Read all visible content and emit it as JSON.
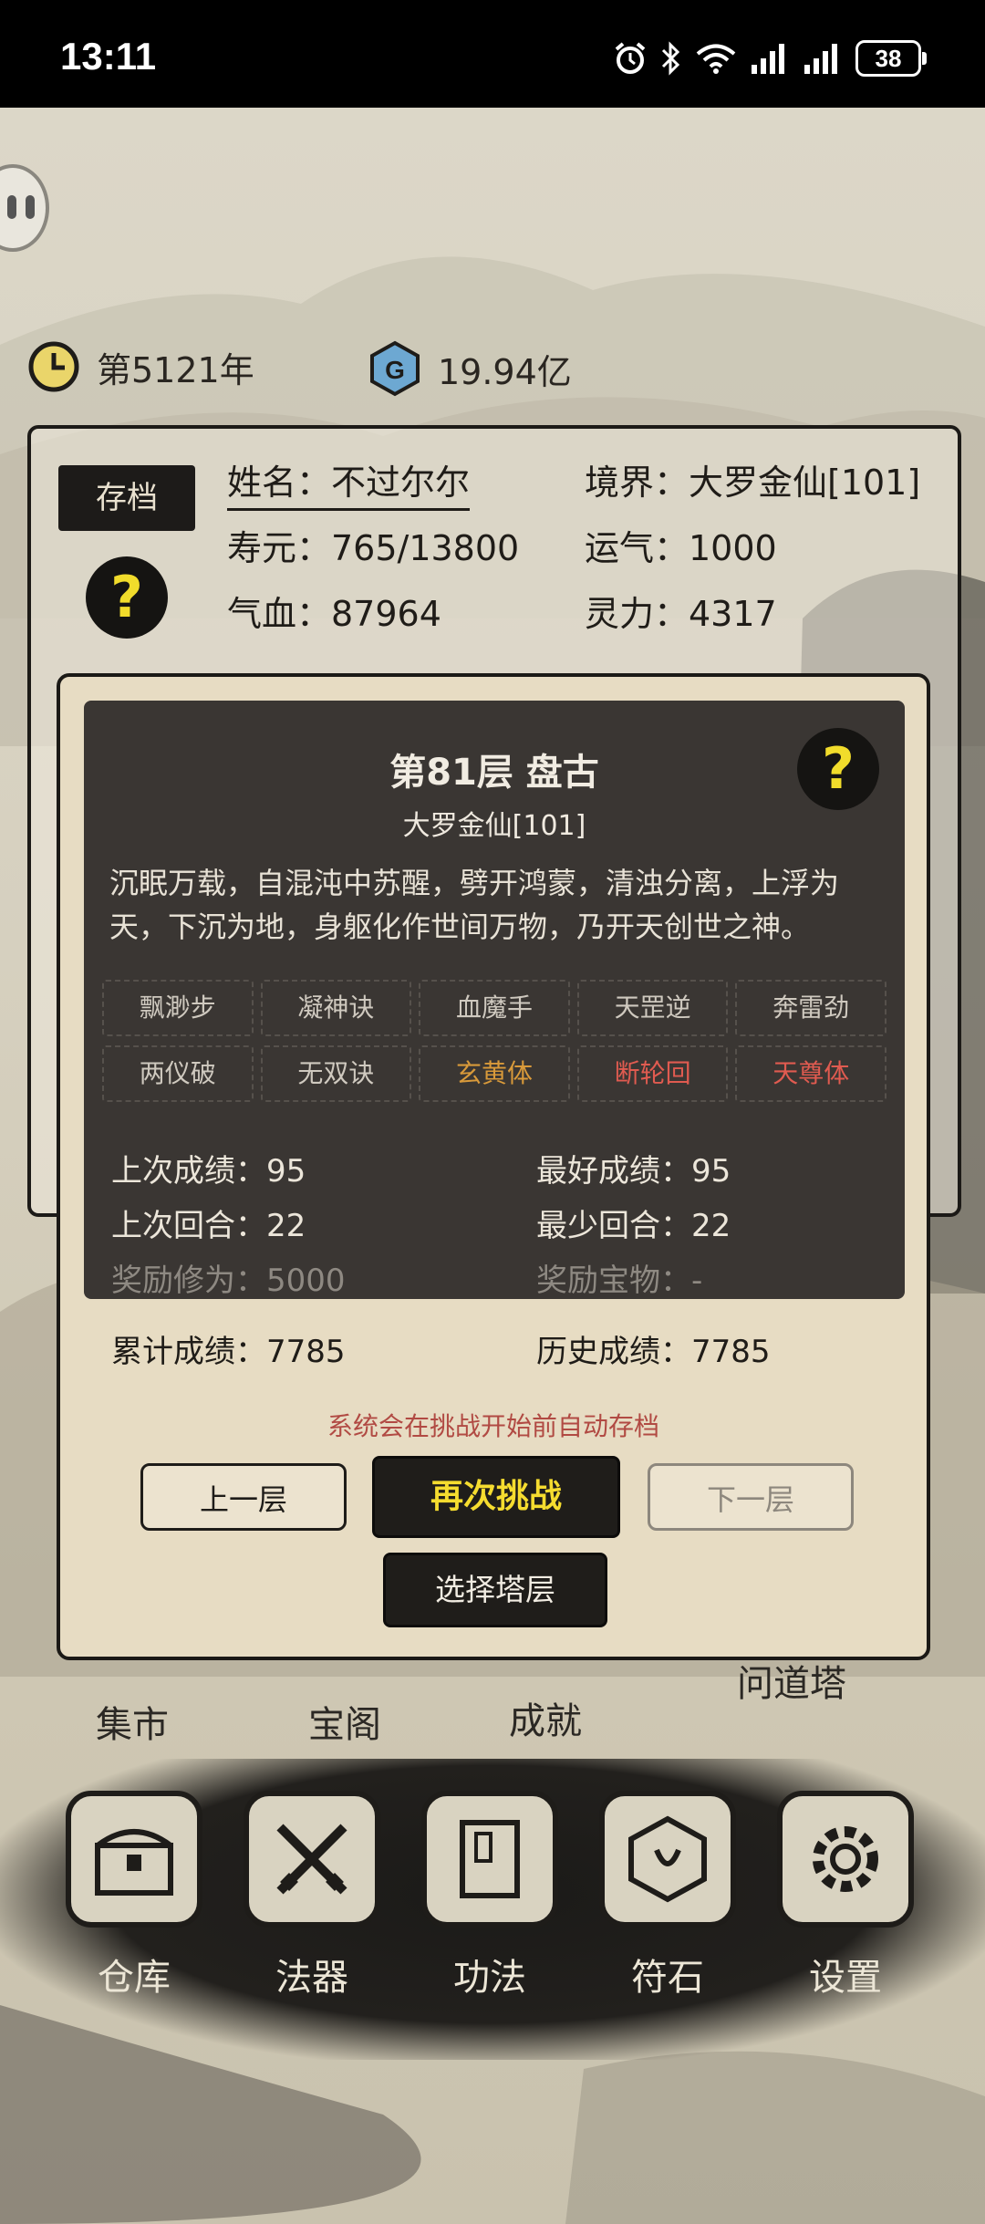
{
  "status_bar": {
    "time": "13:11",
    "battery": "38"
  },
  "resources": {
    "year": "第5121年",
    "gems": "19.94亿"
  },
  "character": {
    "save_button": "存档",
    "help": "?",
    "name": "姓名：不过尔尔",
    "realm": "境界：大罗金仙[101]",
    "lifespan": "寿元：765/13800",
    "luck": "运气：1000",
    "hp": "气血：87964",
    "mana": "灵力：4317"
  },
  "dialog": {
    "title": "第81层 盘古",
    "realm": "大罗金仙[101]",
    "help": "?",
    "description": "沉眠万载，自混沌中苏醒，劈开鸿蒙，清浊分离，上浮为天，下沉为地，身躯化作世间万物，乃开天创世之神。",
    "skills": [
      "飘渺步",
      "凝神诀",
      "血魔手",
      "天罡逆",
      "奔雷劲",
      "两仪破",
      "无双诀",
      "玄黄体",
      "断轮回",
      "天尊体"
    ],
    "last_score": "上次成绩：95",
    "best_score": "最好成绩：95",
    "last_rounds": "上次回合：22",
    "min_rounds": "最少回合：22",
    "reward_exp": "奖励修为：5000",
    "reward_item": "奖励宝物：-",
    "total_score": "累计成绩：7785",
    "history_score": "历史成绩：7785",
    "notice": "系统会在挑战开始前自动存档",
    "prev_button": "上一层",
    "retry_button": "再次挑战",
    "next_button": "下一层",
    "select_button": "选择塔层"
  },
  "scene_nav": {
    "market": "集市",
    "treasure": "宝阁",
    "achievement": "成就",
    "tower": "问道塔"
  },
  "bottom_nav": [
    "仓库",
    "法器",
    "功法",
    "符石",
    "设置"
  ]
}
